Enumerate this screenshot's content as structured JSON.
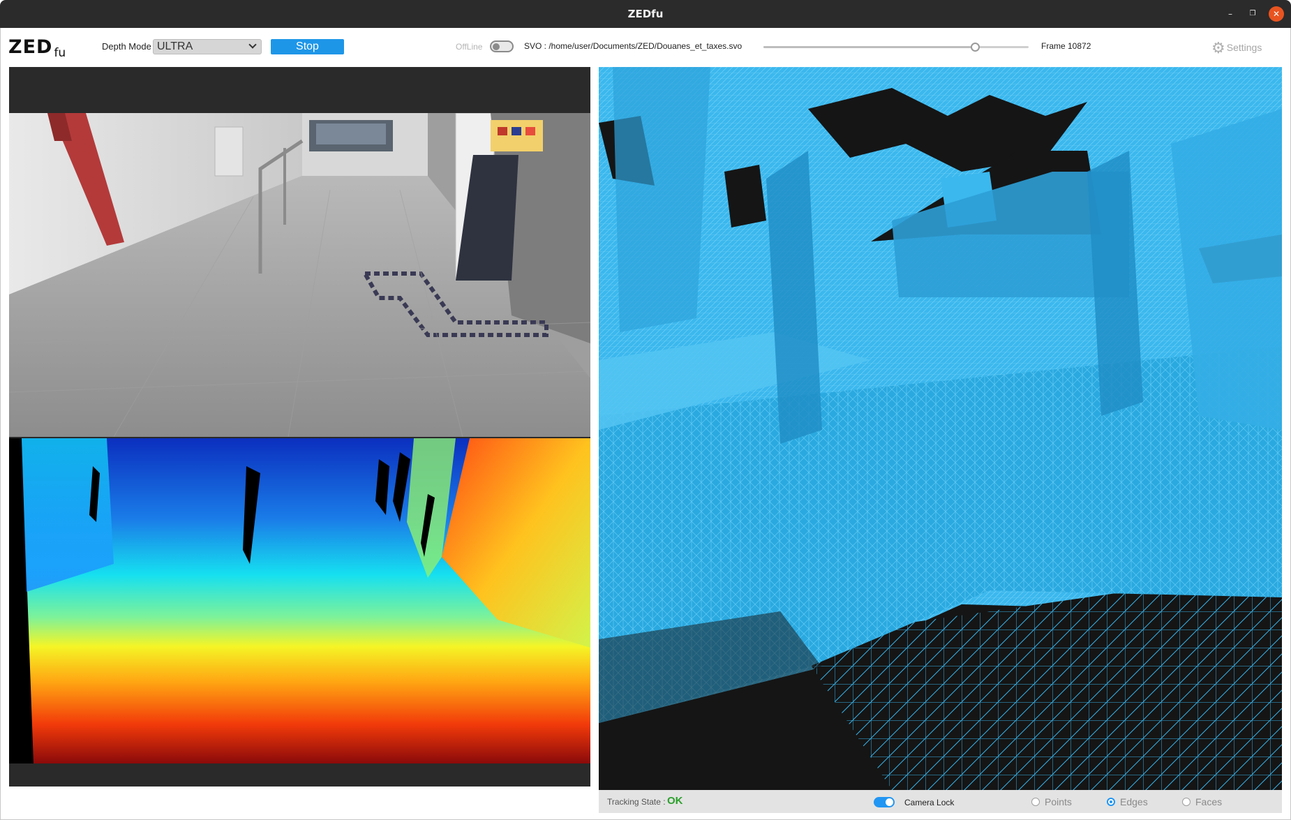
{
  "window": {
    "title": "ZEDfu",
    "minimize_glyph": "–",
    "maximize_glyph": "❐",
    "close_glyph": "✕"
  },
  "toolbar": {
    "logo_main": "ZED",
    "logo_sub": "fu",
    "depth_mode_label": "Depth Mode",
    "depth_mode_value": "ULTRA",
    "stop_label": "Stop",
    "offline_label": "OffLine",
    "offline_enabled": false,
    "svo_path": "SVO : /home/user/Documents/ZED/Douanes_et_taxes.svo",
    "playback_progress": 0.798,
    "frame_label": "Frame 10872",
    "settings_label": "Settings",
    "settings_icon": "gear-icon"
  },
  "views": {
    "rgb": "left camera image",
    "depth": "depth map",
    "mesh": "spatial mapping mesh"
  },
  "colors": {
    "accent": "#1e96e8",
    "mesh": "#39b7ee",
    "ok": "#2ca02c",
    "titlebar": "#2b2b2b",
    "close": "#e95420"
  },
  "status": {
    "tracking_label": "Tracking State :",
    "tracking_value": "OK",
    "camera_lock_label": "Camera Lock",
    "camera_lock_enabled": true,
    "display_modes": [
      "Points",
      "Edges",
      "Faces"
    ],
    "selected_mode": "Edges"
  }
}
